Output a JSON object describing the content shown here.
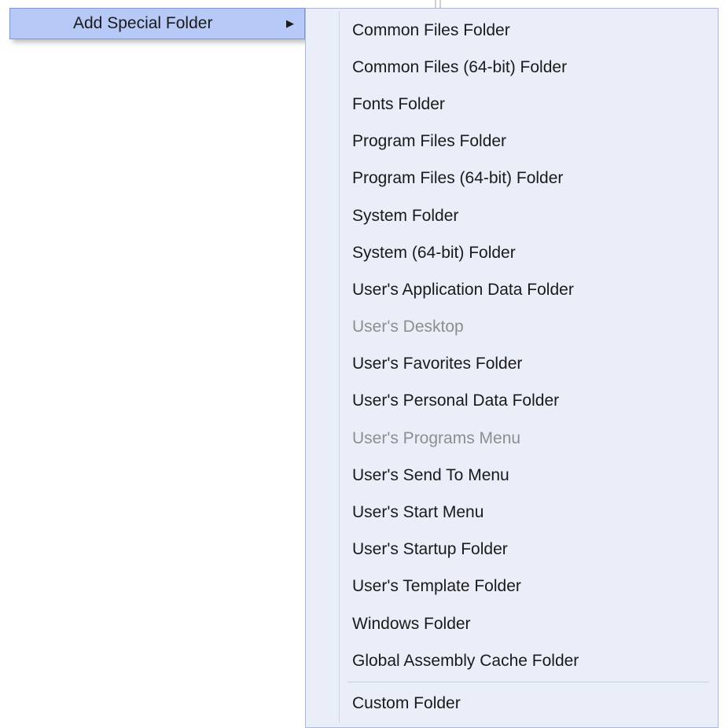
{
  "parent_menu": {
    "label": "Add Special Folder"
  },
  "submenu": {
    "items": [
      {
        "label": "Common Files Folder",
        "disabled": false
      },
      {
        "label": "Common Files (64-bit) Folder",
        "disabled": false
      },
      {
        "label": "Fonts Folder",
        "disabled": false
      },
      {
        "label": "Program Files Folder",
        "disabled": false
      },
      {
        "label": "Program Files (64-bit) Folder",
        "disabled": false
      },
      {
        "label": "System Folder",
        "disabled": false
      },
      {
        "label": "System (64-bit) Folder",
        "disabled": false
      },
      {
        "label": "User's Application Data Folder",
        "disabled": false
      },
      {
        "label": "User's Desktop",
        "disabled": true
      },
      {
        "label": "User's Favorites Folder",
        "disabled": false
      },
      {
        "label": "User's Personal Data Folder",
        "disabled": false
      },
      {
        "label": "User's Programs Menu",
        "disabled": true
      },
      {
        "label": "User's Send To Menu",
        "disabled": false
      },
      {
        "label": "User's Start Menu",
        "disabled": false
      },
      {
        "label": "User's Startup Folder",
        "disabled": false
      },
      {
        "label": "User's Template Folder",
        "disabled": false
      },
      {
        "label": "Windows Folder",
        "disabled": false
      },
      {
        "label": "Global Assembly Cache Folder",
        "disabled": false
      }
    ],
    "footer_item": {
      "label": "Custom Folder",
      "disabled": false
    }
  }
}
